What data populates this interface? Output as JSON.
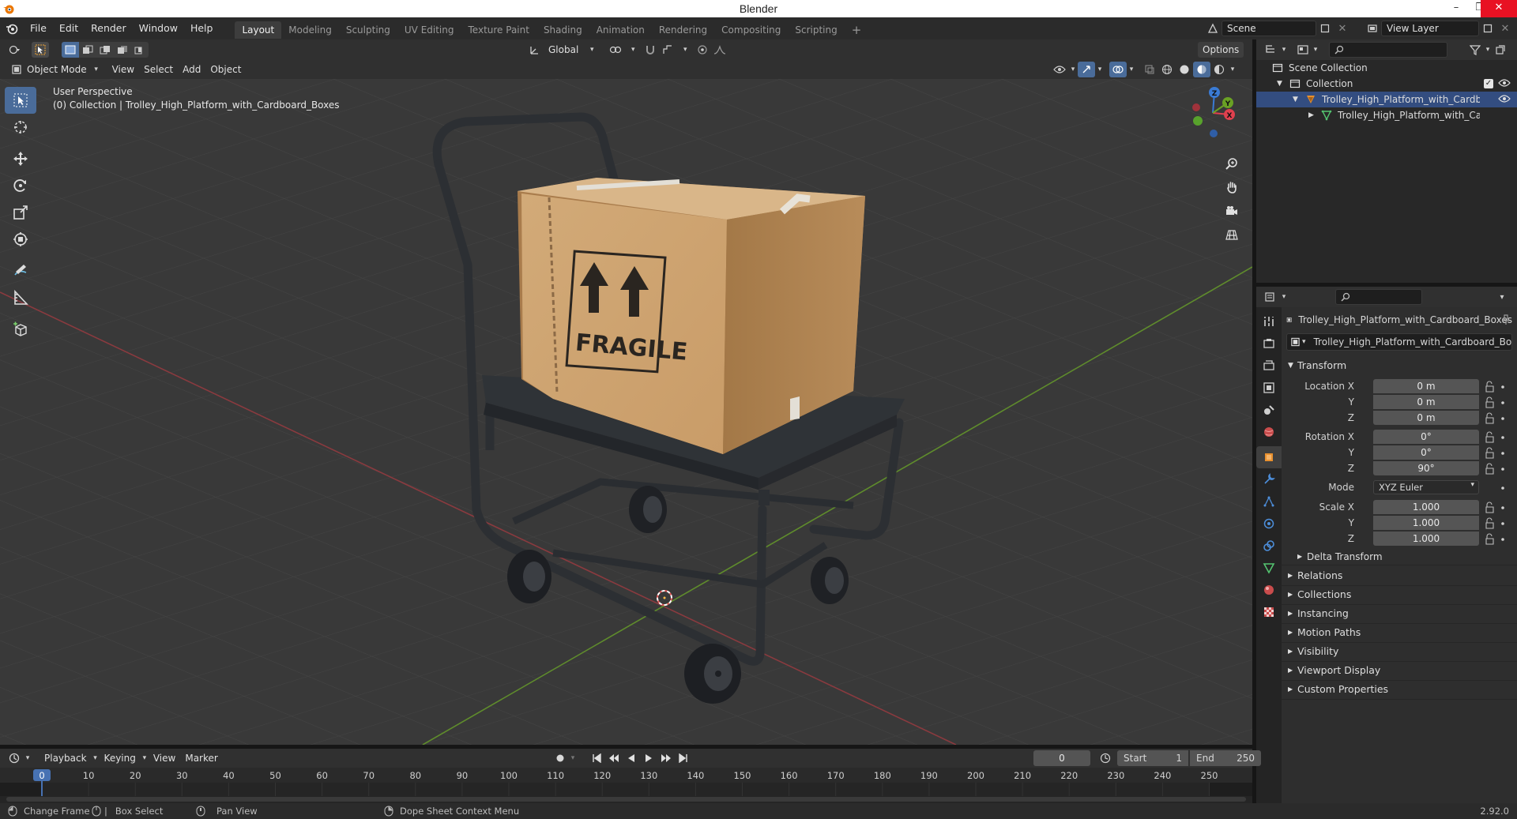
{
  "window": {
    "title": "Blender",
    "minimize": "–",
    "restore": "❐",
    "close": "✕"
  },
  "menubar": {
    "items": [
      "File",
      "Edit",
      "Render",
      "Window",
      "Help"
    ],
    "workspaces": [
      "Layout",
      "Modeling",
      "Sculpting",
      "UV Editing",
      "Texture Paint",
      "Shading",
      "Animation",
      "Rendering",
      "Compositing",
      "Scripting"
    ],
    "add_workspace": "+",
    "scene": "Scene",
    "view_layer": "View Layer"
  },
  "viewport_header": {
    "transform_orientation": "Global",
    "options": "Options"
  },
  "viewport_header2": {
    "mode": "Object Mode",
    "menus": [
      "View",
      "Select",
      "Add",
      "Object"
    ]
  },
  "viewport": {
    "perspective": "User Perspective",
    "collection_info": "(0) Collection | Trolley_High_Platform_with_Cardboard_Boxes",
    "box_label": "FRAGILE",
    "gizmo": {
      "x": "X",
      "y": "Y",
      "z": "Z"
    }
  },
  "outliner": {
    "scene_collection": "Scene Collection",
    "collection": "Collection",
    "object": "Trolley_High_Platform_with_Cardboard_Boxes",
    "mesh": "Trolley_High_Platform_with_Cardboard_Boxes"
  },
  "properties": {
    "object_name": "Trolley_High_Platform_with_Cardboard_Boxes",
    "object_field": "Trolley_High_Platform_with_Cardboard_Boxes",
    "transform": {
      "title": "Transform",
      "location_label": "Location X",
      "y_label": "Y",
      "z_label": "Z",
      "location": [
        "0 m",
        "0 m",
        "0 m"
      ],
      "rotation_label": "Rotation X",
      "rotation": [
        "0°",
        "0°",
        "90°"
      ],
      "mode_label": "Mode",
      "mode": "XYZ Euler",
      "scale_label": "Scale X",
      "scale": [
        "1.000",
        "1.000",
        "1.000"
      ],
      "delta": "Delta Transform"
    },
    "panels": [
      "Relations",
      "Collections",
      "Instancing",
      "Motion Paths",
      "Visibility",
      "Viewport Display",
      "Custom Properties"
    ]
  },
  "timeline": {
    "menus": [
      "Playback",
      "Keying",
      "View",
      "Marker"
    ],
    "current_frame": "0",
    "start_label": "Start",
    "start": "1",
    "end_label": "End",
    "end": "250",
    "ticks": [
      "0",
      "10",
      "20",
      "30",
      "40",
      "50",
      "60",
      "70",
      "80",
      "90",
      "100",
      "110",
      "120",
      "130",
      "140",
      "150",
      "160",
      "170",
      "180",
      "190",
      "200",
      "210",
      "220",
      "230",
      "240",
      "250"
    ]
  },
  "statusbar": {
    "items": [
      "Change Frame",
      "Box Select",
      "Pan View",
      "Dope Sheet Context Menu"
    ],
    "version": "2.92.0"
  }
}
